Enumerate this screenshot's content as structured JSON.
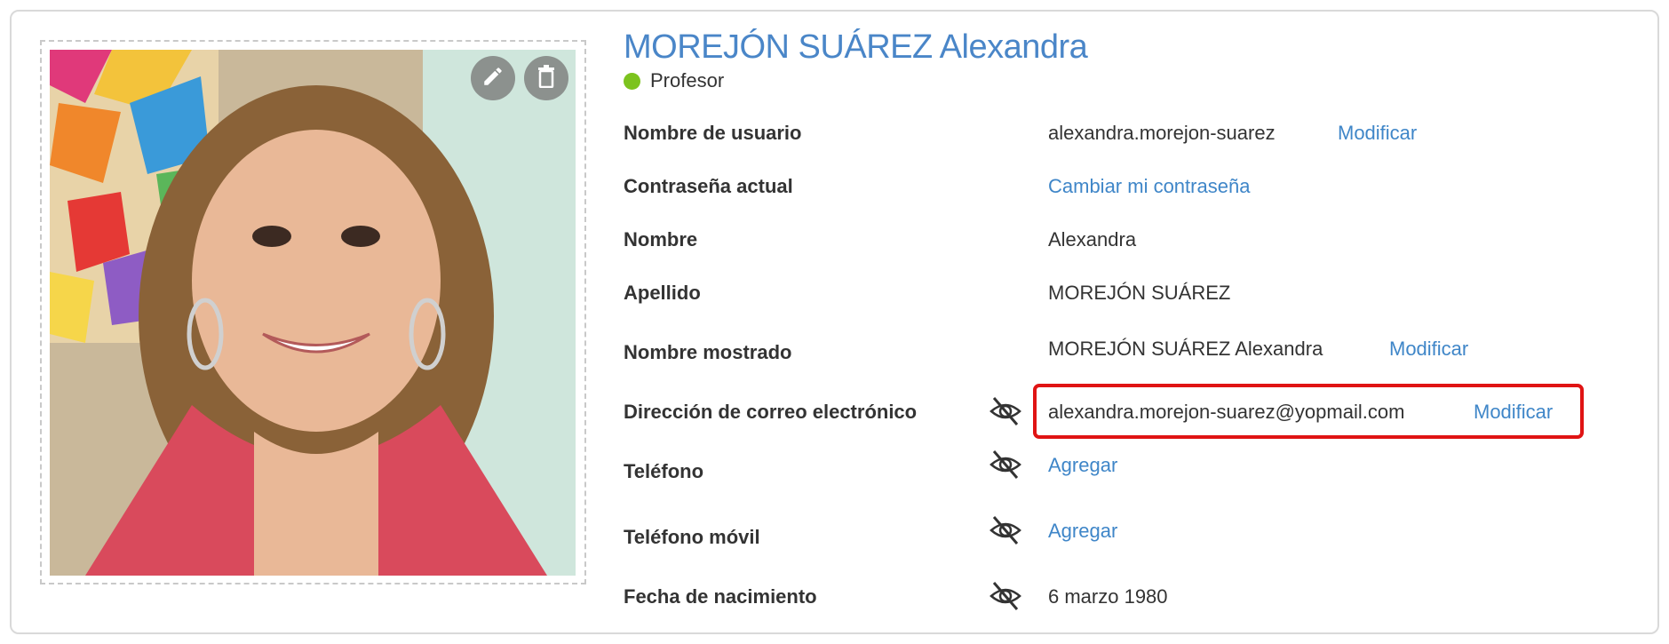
{
  "profile": {
    "full_name": "MOREJÓN SUÁREZ Alexandra",
    "role": "Profesor",
    "status_color": "#7cc31e"
  },
  "photo": {
    "edit_icon": "pencil-icon",
    "delete_icon": "trash-icon"
  },
  "fields": {
    "username": {
      "label": "Nombre de usuario",
      "value": "alexandra.morejon-suarez",
      "action": "Modificar"
    },
    "password": {
      "label": "Contraseña actual",
      "action": "Cambiar mi contraseña"
    },
    "first_name": {
      "label": "Nombre",
      "value": "Alexandra"
    },
    "last_name": {
      "label": "Apellido",
      "value": "MOREJÓN SUÁREZ"
    },
    "display_name": {
      "label": "Nombre mostrado",
      "value": "MOREJÓN SUÁREZ Alexandra",
      "action": "Modificar"
    },
    "email": {
      "label": "Dirección de correo electrónico",
      "value": "alexandra.morejon-suarez@yopmail.com",
      "action": "Modificar",
      "visibility_icon": "eye-slash-icon"
    },
    "phone": {
      "label": "Teléfono",
      "action": "Agregar",
      "visibility_icon": "eye-slash-icon"
    },
    "mobile": {
      "label": "Teléfono móvil",
      "action": "Agregar",
      "visibility_icon": "eye-slash-icon"
    },
    "birthdate": {
      "label": "Fecha de nacimiento",
      "value": "6 marzo 1980",
      "visibility_icon": "eye-slash-icon"
    }
  },
  "colors": {
    "accent": "#4a86c8",
    "link": "#3f86c8",
    "highlight": "#e01414"
  }
}
